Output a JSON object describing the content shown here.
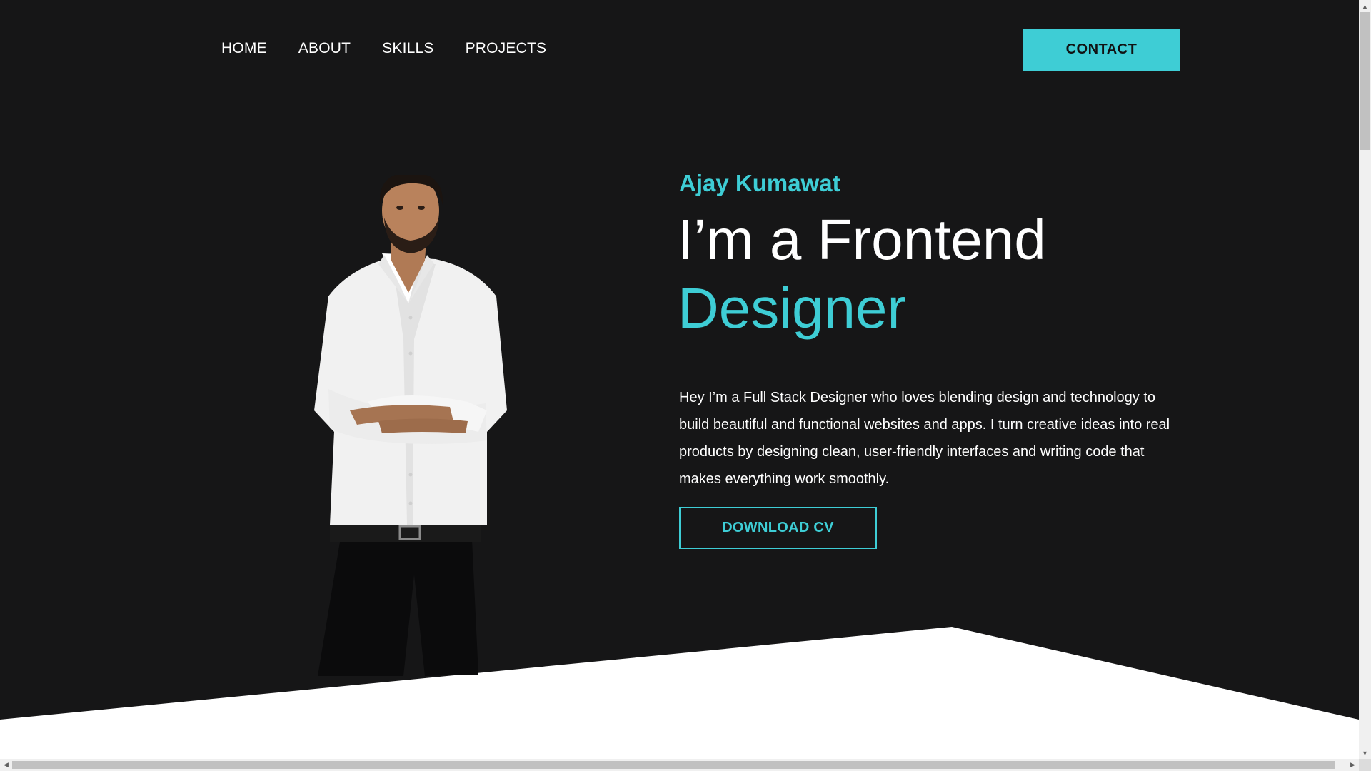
{
  "nav": {
    "items": [
      "HOME",
      "ABOUT",
      "SKILLS",
      "PROJECTS"
    ],
    "contact_label": "CONTACT"
  },
  "hero": {
    "name": "Ajay Kumawat",
    "title_line1": "I’m a Frontend",
    "title_line2": "Designer",
    "description": "Hey I’m a Full Stack Designer who loves blending design and technology to build beautiful and functional websites and apps. I turn creative ideas into real products by designing clean, user-friendly interfaces and writing code that makes everything work smoothly.",
    "cv_label": "DOWNLOAD CV"
  },
  "colors": {
    "background": "#161617",
    "accent": "#3ecdd5",
    "text": "#ffffff",
    "bottom": "#ffffff"
  },
  "icons": {
    "scroll_up": "up-arrow-icon",
    "scroll_down": "down-arrow-icon",
    "scroll_left": "left-arrow-icon",
    "scroll_right": "right-arrow-icon"
  }
}
